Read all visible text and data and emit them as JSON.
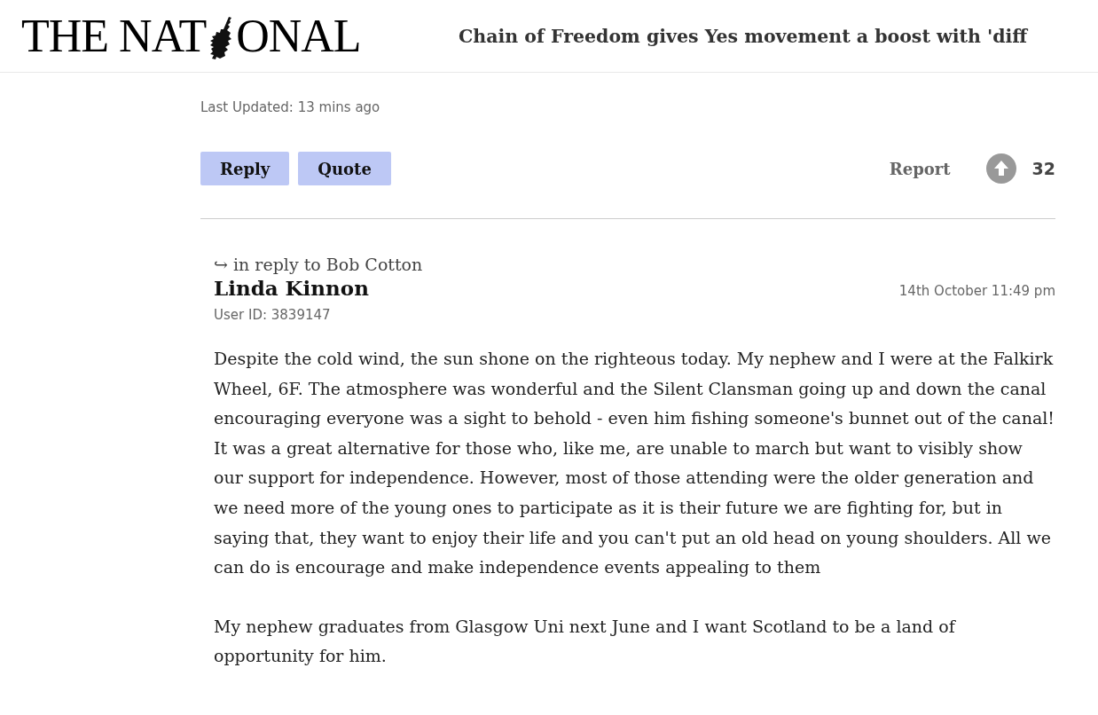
{
  "header": {
    "logo": [
      "THE NAT",
      "ONAL"
    ],
    "headline": "Chain of Freedom gives Yes movement a boost with 'diff"
  },
  "previous_comment": {
    "last_updated": "Last Updated: 13 mins ago",
    "actions": [
      "Reply",
      "Quote"
    ],
    "report": "Report",
    "votes": "32"
  },
  "comment": {
    "in_reply_to": "↪ in reply to Bob Cotton",
    "author": "Linda Kinnon",
    "date": "14th October 11:49 pm",
    "user_id": "User ID: 3839147",
    "paragraphs": [
      "Despite the cold wind, the sun shone on the righteous today. My nephew and I were at the Falkirk Wheel, 6F. The atmosphere was wonderful and the Silent Clansman going up and down the canal encouraging everyone was a sight to behold - even him fishing someone's bunnet out of the canal! It was a great alternative for those who, like me, are unable to march but want to visibly show our support for independence. However, most of those attending were the older generation and we need more of the young ones to participate as it is their future we are fighting for, but in saying that, they want to enjoy their life and you can't put an old head on young shoulders. All we can do is encourage and make independence events appealing to them",
      "My nephew graduates from Glasgow Uni next June and I want Scotland to be a land of opportunity for him."
    ]
  }
}
